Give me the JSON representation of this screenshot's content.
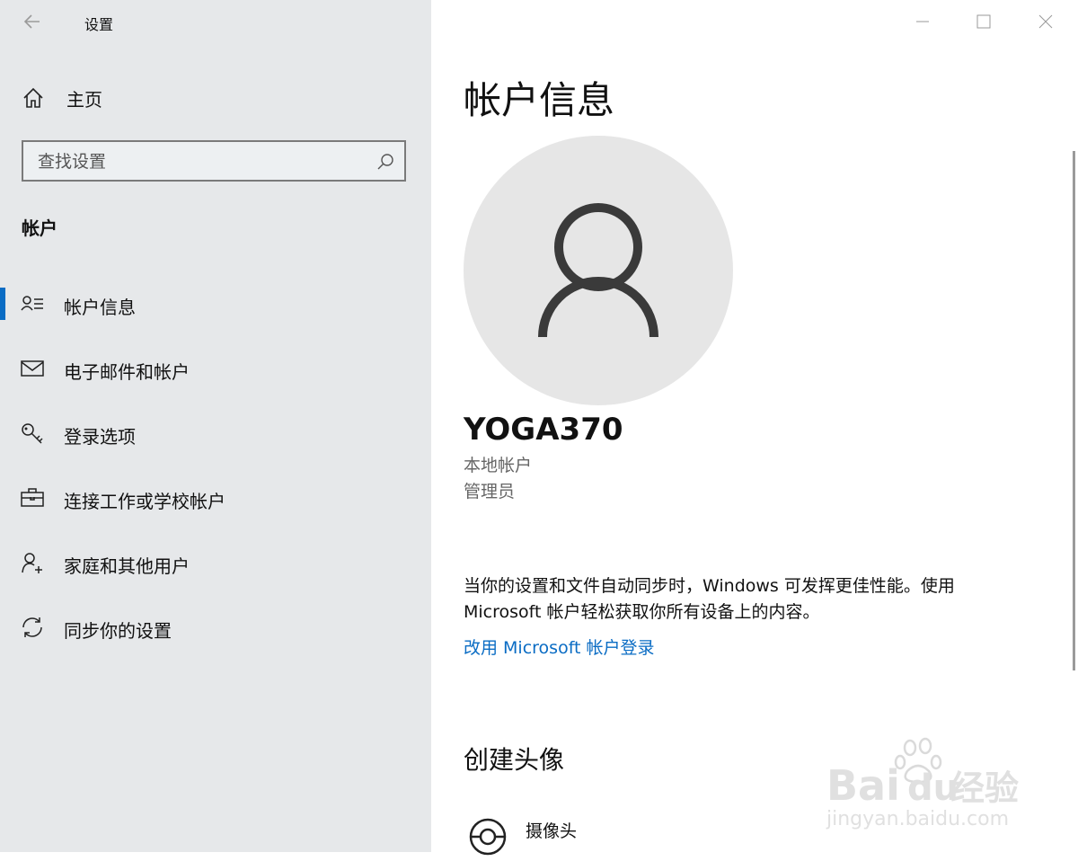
{
  "window": {
    "app_title": "设置"
  },
  "sidebar": {
    "home_label": "主页",
    "search_placeholder": "查找设置",
    "section_title": "帐户",
    "items": [
      {
        "label": "帐户信息",
        "icon": "account-info-icon",
        "selected": true
      },
      {
        "label": "电子邮件和帐户",
        "icon": "mail-icon",
        "selected": false
      },
      {
        "label": "登录选项",
        "icon": "key-icon",
        "selected": false
      },
      {
        "label": "连接工作或学校帐户",
        "icon": "briefcase-icon",
        "selected": false
      },
      {
        "label": "家庭和其他用户",
        "icon": "add-person-icon",
        "selected": false
      },
      {
        "label": "同步你的设置",
        "icon": "sync-icon",
        "selected": false
      }
    ]
  },
  "main": {
    "page_title": "帐户信息",
    "username": "YOGA370",
    "account_type": "本地帐户",
    "account_role": "管理员",
    "sync_message": "当你的设置和文件自动同步时，Windows 可发挥更佳性能。使用 Microsoft 帐户轻松获取你所有设备上的内容。",
    "switch_link": "改用 Microsoft 帐户登录",
    "create_avatar_title": "创建头像",
    "camera_label": "摄像头"
  },
  "watermark": {
    "brand": "Bai",
    "brand2": "du",
    "brand_cn": "经验",
    "url": "jingyan.baidu.com"
  },
  "colors": {
    "accent": "#0a6cc4",
    "sidebar_bg": "#e6e8ea",
    "avatar_bg": "#e6e6e6"
  }
}
